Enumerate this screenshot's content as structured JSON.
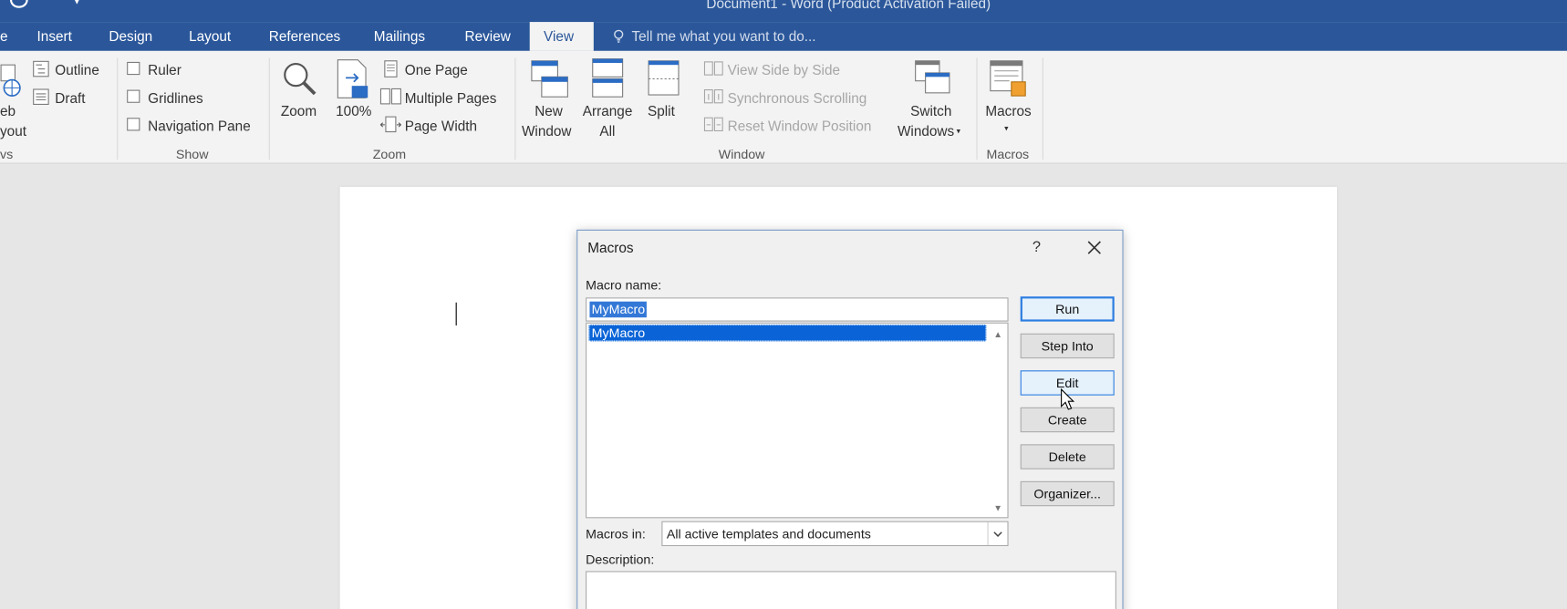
{
  "window": {
    "title": "Document1 - Word (Product Activation Failed)"
  },
  "tabs": [
    {
      "label": "e"
    },
    {
      "label": "Insert"
    },
    {
      "label": "Design"
    },
    {
      "label": "Layout"
    },
    {
      "label": "References"
    },
    {
      "label": "Mailings"
    },
    {
      "label": "Review"
    },
    {
      "label": "View"
    }
  ],
  "tell_me": "Tell me what you want to do...",
  "ribbon": {
    "views": {
      "web_layout_line1": "eb",
      "web_layout_line2": "yout",
      "outline": "Outline",
      "draft": "Draft",
      "group": "vs"
    },
    "show": {
      "ruler": "Ruler",
      "gridlines": "Gridlines",
      "navigation_pane": "Navigation Pane",
      "group": "Show"
    },
    "zoom": {
      "zoom": "Zoom",
      "hundred": "100%",
      "one_page": "One Page",
      "multiple_pages": "Multiple Pages",
      "page_width": "Page Width",
      "group": "Zoom"
    },
    "window": {
      "new_window_1": "New",
      "new_window_2": "Window",
      "arrange_all_1": "Arrange",
      "arrange_all_2": "All",
      "split": "Split",
      "view_side_by_side": "View Side by Side",
      "synchronous_scrolling": "Synchronous Scrolling",
      "reset_window_position": "Reset Window Position",
      "switch_windows_1": "Switch",
      "switch_windows_2": "Windows",
      "group": "Window"
    },
    "macros": {
      "label": "Macros",
      "group": "Macros"
    }
  },
  "dialog": {
    "title": "Macros",
    "help": "?",
    "macro_name_label": "Macro name:",
    "macro_name_value": "MyMacro",
    "macro_list": [
      "MyMacro"
    ],
    "buttons": {
      "run": "Run",
      "step_into": "Step Into",
      "edit": "Edit",
      "create": "Create",
      "delete": "Delete",
      "organizer": "Organizer..."
    },
    "macros_in_label": "Macros in:",
    "macros_in_value": "All active templates and documents",
    "description_label": "Description:"
  },
  "colors": {
    "accent": "#2b579a",
    "selection": "#0a64d7",
    "ribbon_bg": "#f3f3f3",
    "doc_bg": "#e6e6e6"
  }
}
